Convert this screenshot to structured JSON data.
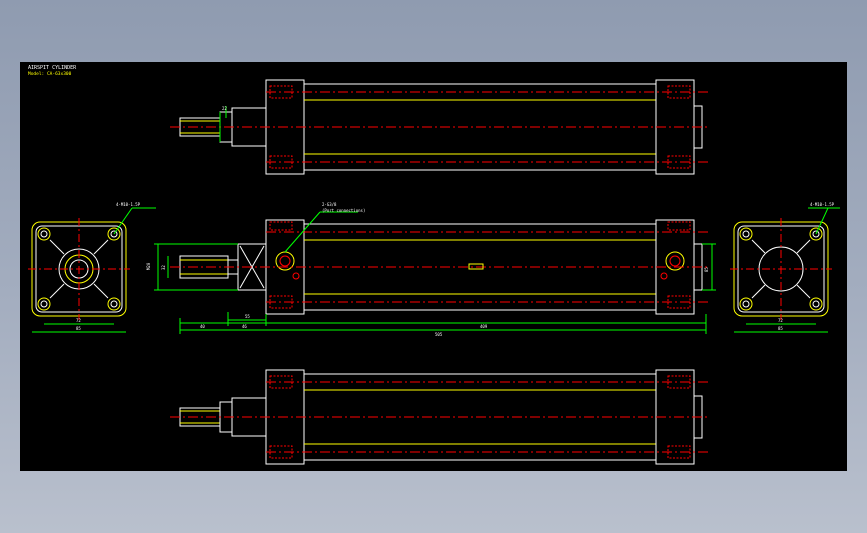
{
  "drawing": {
    "title": "AIRSPIT CYLINDER",
    "subtitle": "Model: CA-63x300",
    "colors": {
      "background": "#000000",
      "outline": "#ffffff",
      "yellow_line": "#ffff00",
      "center_line": "#ff0000",
      "dimension": "#00ff00",
      "port": "#ff0000"
    }
  },
  "notes": {
    "port_top": "2-G3/8",
    "port_top_sub": "(Port connections)",
    "holes_left": "4-M10-1.5P",
    "holes_right": "4-M10-1.5P"
  },
  "dims": {
    "width_72_left": "72",
    "width_85_left": "85",
    "width_72_right": "72",
    "width_85_right": "85",
    "len_40": "40",
    "len_46": "46",
    "len_55": "55",
    "len_total": "505",
    "len_body": "409",
    "dia_rod": "M20",
    "dia_rod2": "32",
    "h_right": "85",
    "h_top": "22"
  }
}
